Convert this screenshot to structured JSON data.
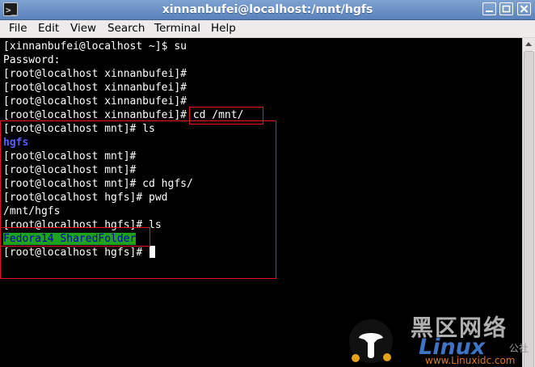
{
  "window": {
    "title": "xinnanbufei@localhost:/mnt/hgfs",
    "icon_glyph": ">_",
    "controls": [
      "minimize-icon",
      "maximize-icon",
      "close-icon"
    ]
  },
  "menu": [
    "File",
    "Edit",
    "View",
    "Search",
    "Terminal",
    "Help"
  ],
  "terminal": {
    "lines": [
      "[xinnanbufei@localhost ~]$ su",
      "Password:",
      "[root@localhost xinnanbufei]#",
      "[root@localhost xinnanbufei]#",
      "[root@localhost xinnanbufei]#",
      "[root@localhost xinnanbufei]# cd /mnt/",
      "[root@localhost mnt]# ls",
      "hgfs",
      "[root@localhost mnt]#",
      "[root@localhost mnt]#",
      "[root@localhost mnt]# cd hgfs/",
      "[root@localhost hgfs]# pwd",
      "/mnt/hgfs",
      "[root@localhost hgfs]# ls",
      "Fedora14 SharedFolder",
      "[root@localhost hgfs]# "
    ],
    "directory_color": "#5c5cff",
    "shared_folder_bg": "#1ea21e",
    "shared_folder_fg": "#0000aa",
    "annotation_color": "#e8111b"
  },
  "watermark": {
    "top_text": "黑区网络",
    "brand": "Linux",
    "cn_suffix": "公社",
    "url": "www.Linuxidc.com"
  }
}
